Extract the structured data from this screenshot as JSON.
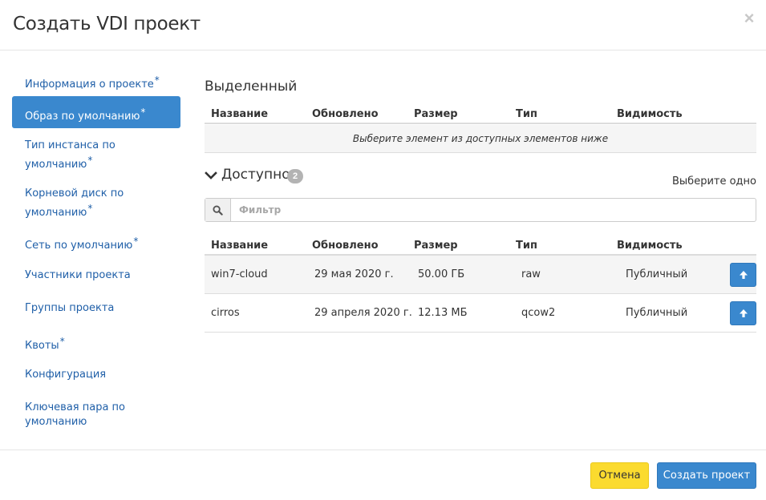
{
  "dialog": {
    "title": "Создать VDI проект",
    "close_glyph": "×"
  },
  "sidebar": {
    "items": [
      {
        "label": "Информация о проекте",
        "required": true,
        "active": false
      },
      {
        "label": "Образ по умолчанию",
        "required": true,
        "active": true
      },
      {
        "label": "Тип инстанса по умолчанию",
        "required": true,
        "active": false
      },
      {
        "label": "Корневой диск по умолчанию",
        "required": true,
        "active": false
      },
      {
        "label": "Сеть по умолчанию",
        "required": true,
        "active": false
      },
      {
        "label": "Участники проекта",
        "required": false,
        "active": false
      },
      {
        "label": "Группы проекта",
        "required": false,
        "active": false
      },
      {
        "label": "Квоты",
        "required": true,
        "active": false
      },
      {
        "label": "Конфигурация",
        "required": false,
        "active": false
      },
      {
        "label": "Ключевая пара по умолчанию",
        "required": false,
        "active": false
      }
    ],
    "required_mark": "*"
  },
  "selected": {
    "title": "Выделенный",
    "columns": [
      "Название",
      "Обновлено",
      "Размер",
      "Тип",
      "Видимость"
    ],
    "empty_message": "Выберите элемент из доступных элементов ниже"
  },
  "available": {
    "title": "Доступно",
    "count": "2",
    "hint": "Выберите одно",
    "filter_placeholder": "Фильтр",
    "columns": [
      "Название",
      "Обновлено",
      "Размер",
      "Тип",
      "Видимость"
    ],
    "rows": [
      {
        "name": "win7-cloud",
        "updated": "29 мая 2020 г.",
        "size": "50.00 ГБ",
        "type": "raw",
        "visibility": "Публичный"
      },
      {
        "name": "cirros",
        "updated": "29 апреля 2020 г.",
        "size": "12.13 МБ",
        "type": "qcow2",
        "visibility": "Публичный"
      }
    ]
  },
  "footer": {
    "cancel_label": "Отмена",
    "create_label": "Создать проект"
  },
  "colors": {
    "accent": "#3a88ce",
    "link": "#1f5fa8",
    "cancel": "#fbdb2f",
    "badge": "#b3b3b3"
  },
  "icons": {
    "close": "close-icon",
    "chevron": "chevron-down-icon",
    "search": "search-icon",
    "add": "arrow-up-icon"
  }
}
